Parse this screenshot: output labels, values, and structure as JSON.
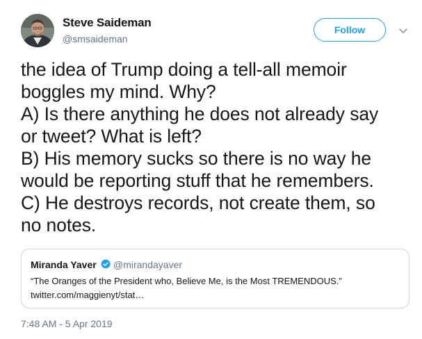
{
  "author": {
    "name": "Steve Saideman",
    "handle": "@smsaideman",
    "avatar_icon": "profile-photo"
  },
  "follow_label": "Follow",
  "tweet": {
    "text": "the idea of Trump doing a tell-all memoir\nboggles my mind.  Why?\nA) Is there anything he does not already say\nor tweet?  What is left?\nB) His memory sucks so there is no way he\nwould be reporting stuff that he remembers.\nC) He destroys records, not create them, so\nno notes."
  },
  "quoted_tweet": {
    "name": "Miranda Yaver",
    "handle": "@mirandayaver",
    "verified": true,
    "text": "“The Oranges of the President who, Believe Me, is the Most TREMENDOUS.”",
    "link": "twitter.com/maggienyt/stat…"
  },
  "timestamp": "7:48 AM - 5 Apr 2019",
  "colors": {
    "accent": "#1da1f2",
    "secondary_text": "#657786",
    "border": "#ccd6dd"
  }
}
